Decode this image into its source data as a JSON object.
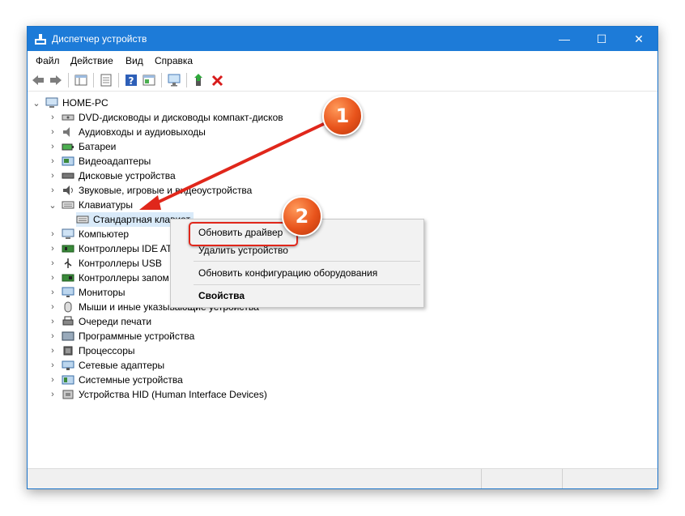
{
  "window": {
    "title": "Диспетчер устройств",
    "controls": {
      "minimize": "—",
      "maximize": "☐",
      "close": "✕"
    }
  },
  "menu": [
    "Файл",
    "Действие",
    "Вид",
    "Справка"
  ],
  "toolbar_icons": [
    "back-arrow-icon",
    "forward-arrow-icon",
    "show-hide-tree-icon",
    "properties-icon",
    "help-icon",
    "action-view-icon",
    "scan-hardware-icon",
    "update-driver-icon",
    "uninstall-device-icon"
  ],
  "tree": {
    "root": "HOME-PC",
    "items": [
      {
        "label": "DVD-дисководы и дисководы компакт-дисков",
        "icon": "dvd-drive-icon",
        "expanded": false
      },
      {
        "label": "Аудиовходы и аудиовыходы",
        "icon": "speaker-icon",
        "expanded": false
      },
      {
        "label": "Батареи",
        "icon": "battery-icon",
        "expanded": false
      },
      {
        "label": "Видеоадаптеры",
        "icon": "display-adapter-icon",
        "expanded": false
      },
      {
        "label": "Дисковые устройства",
        "icon": "disk-drive-icon",
        "expanded": false
      },
      {
        "label": "Звуковые, игровые и видеоустройства",
        "icon": "sound-device-icon",
        "expanded": false
      },
      {
        "label": "Клавиатуры",
        "icon": "keyboard-icon",
        "expanded": true
      },
      {
        "label": "Компьютер",
        "icon": "computer-icon",
        "expanded": false
      },
      {
        "label": "Контроллеры IDE ATA",
        "icon": "ide-controller-icon",
        "expanded": false
      },
      {
        "label": "Контроллеры USB",
        "icon": "usb-controller-icon",
        "expanded": false
      },
      {
        "label": "Контроллеры запом",
        "icon": "storage-controller-icon",
        "expanded": false
      },
      {
        "label": "Мониторы",
        "icon": "monitor-icon",
        "expanded": false
      },
      {
        "label": "Мыши и иные указывающие устройства",
        "icon": "mouse-icon",
        "expanded": false
      },
      {
        "label": "Очереди печати",
        "icon": "printer-icon",
        "expanded": false
      },
      {
        "label": "Программные устройства",
        "icon": "software-device-icon",
        "expanded": false
      },
      {
        "label": "Процессоры",
        "icon": "processor-icon",
        "expanded": false
      },
      {
        "label": "Сетевые адаптеры",
        "icon": "network-adapter-icon",
        "expanded": false
      },
      {
        "label": "Системные устройства",
        "icon": "system-device-icon",
        "expanded": false
      },
      {
        "label": "Устройства HID (Human Interface Devices)",
        "icon": "hid-device-icon",
        "expanded": false
      }
    ],
    "keyboard_child": "Стандартная клавиат"
  },
  "context_menu": {
    "items": [
      "Обновить драйвер",
      "Удалить устройство",
      "Обновить конфигурацию оборудования",
      "Свойства"
    ]
  },
  "annotations": {
    "badge1": "1",
    "badge2": "2"
  },
  "colors": {
    "titlebar": "#1d7bd8",
    "accent_red": "#e0271b",
    "badge": "#e8531b",
    "selection": "#cce8ff"
  }
}
